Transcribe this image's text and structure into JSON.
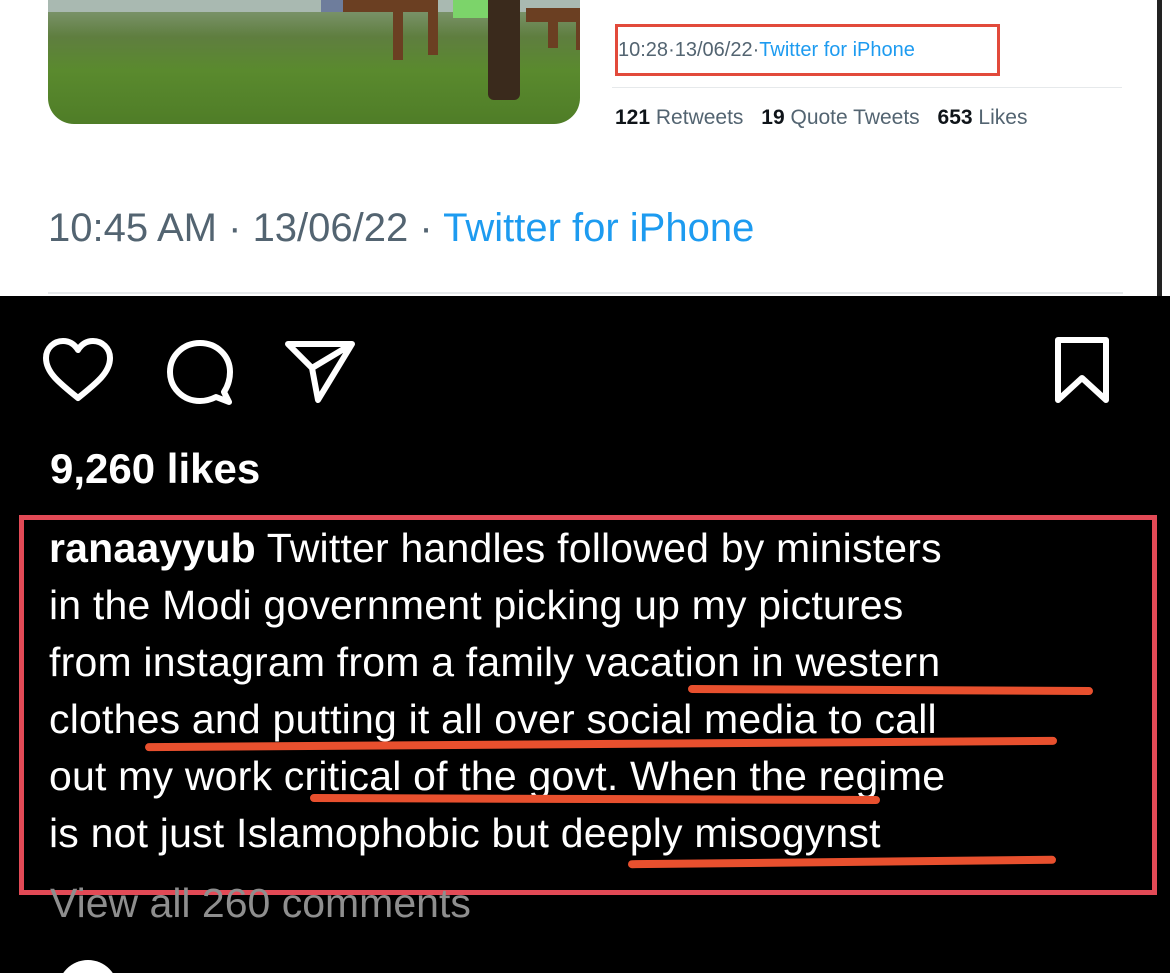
{
  "quoted_tweet": {
    "meta_time": "10:28",
    "meta_date": "13/06/22",
    "meta_source": "Twitter for iPhone",
    "separator": " · ",
    "stats": {
      "retweets_count": "121",
      "retweets_label": "Retweets",
      "quotes_count": "19",
      "quotes_label": "Quote Tweets",
      "likes_count": "653",
      "likes_label": "Likes"
    }
  },
  "tweet": {
    "time": "10:45 AM",
    "date": "13/06/22",
    "source": "Twitter for iPhone",
    "separator": " · "
  },
  "instagram": {
    "actions": {
      "like_icon": "heart-icon",
      "comment_icon": "comment-icon",
      "share_icon": "send-icon",
      "save_icon": "bookmark-icon"
    },
    "likes_text": "9,260 likes",
    "caption": {
      "username": "ranaayyub",
      "line1": " Twitter handles followed by ministers",
      "line2": "in the Modi government picking up my pictures",
      "line3": "from instagram from a family vacation in western",
      "line4": "clothes and putting it all over social media to call",
      "line5": "out my work critical of the govt. When the regime",
      "line6": "is not just Islamophobic but deeply misogynst"
    },
    "view_all_comments": "View all 260 comments"
  },
  "colors": {
    "highlight_box": "#e24a56",
    "underline": "#e8502e",
    "twitter_blue": "#1d9bf0",
    "meta_gray": "#536471"
  }
}
